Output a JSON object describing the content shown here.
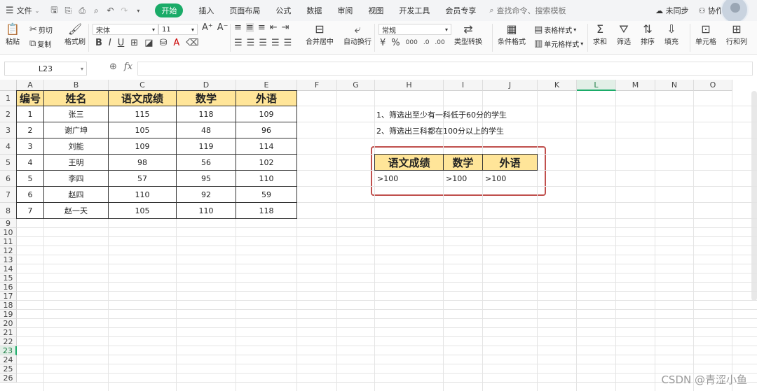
{
  "menu": {
    "file": "文件",
    "tabs": [
      "开始",
      "插入",
      "页面布局",
      "公式",
      "数据",
      "审阅",
      "视图",
      "开发工具",
      "会员专享"
    ],
    "active_tab": 0,
    "search_placeholder": "查找命令、搜索模板",
    "unsynced": "未同步",
    "collab": "协作"
  },
  "toolbar": {
    "paste": "粘贴",
    "cut": "剪切",
    "copy": "复制",
    "format_painter": "格式刷",
    "font_name": "宋体",
    "font_size": "11",
    "merge_center": "合并居中",
    "wrap_text": "自动换行",
    "number_format": "常规",
    "type_convert": "类型转换",
    "cond_format": "条件格式",
    "table_style": "表格样式",
    "cell_style": "单元格样式",
    "sum": "求和",
    "filter": "筛选",
    "sort": "排序",
    "fill": "填充",
    "cells": "单元格",
    "row_col": "行和列"
  },
  "formula_bar": {
    "name_box": "L23",
    "fx": "fx",
    "value": ""
  },
  "columns": [
    "A",
    "B",
    "C",
    "D",
    "E",
    "F",
    "G",
    "H",
    "I",
    "J",
    "K",
    "L",
    "M",
    "N",
    "O"
  ],
  "selected_column": "L",
  "selected_row": "23",
  "rows": [
    "1",
    "2",
    "3",
    "4",
    "5",
    "6",
    "7",
    "8",
    "9",
    "10",
    "11",
    "12",
    "13",
    "14",
    "15",
    "16",
    "17",
    "18",
    "19",
    "20",
    "21",
    "22",
    "23",
    "24",
    "25",
    "26"
  ],
  "table": {
    "headers": [
      "编号",
      "姓名",
      "语文成绩",
      "数学",
      "外语"
    ],
    "rows": [
      [
        "1",
        "张三",
        "115",
        "118",
        "109"
      ],
      [
        "2",
        "谢广坤",
        "105",
        "48",
        "96"
      ],
      [
        "3",
        "刘能",
        "109",
        "119",
        "114"
      ],
      [
        "4",
        "王明",
        "98",
        "56",
        "102"
      ],
      [
        "5",
        "李四",
        "57",
        "95",
        "110"
      ],
      [
        "6",
        "赵四",
        "110",
        "92",
        "59"
      ],
      [
        "7",
        "赵一天",
        "105",
        "110",
        "118"
      ]
    ]
  },
  "notes": [
    "1、筛选出至少有一科低于60分的学生",
    "2、筛选出三科都在100分以上的学生"
  ],
  "criteria": {
    "headers": [
      "语文成绩",
      "数学",
      "外语"
    ],
    "values": [
      ">100",
      ">100",
      ">100"
    ]
  },
  "colors": {
    "header_fill": "#ffe599",
    "accent": "#1aab68",
    "highlight_box": "#c0504d"
  },
  "watermark": "CSDN @青涩小鱼"
}
